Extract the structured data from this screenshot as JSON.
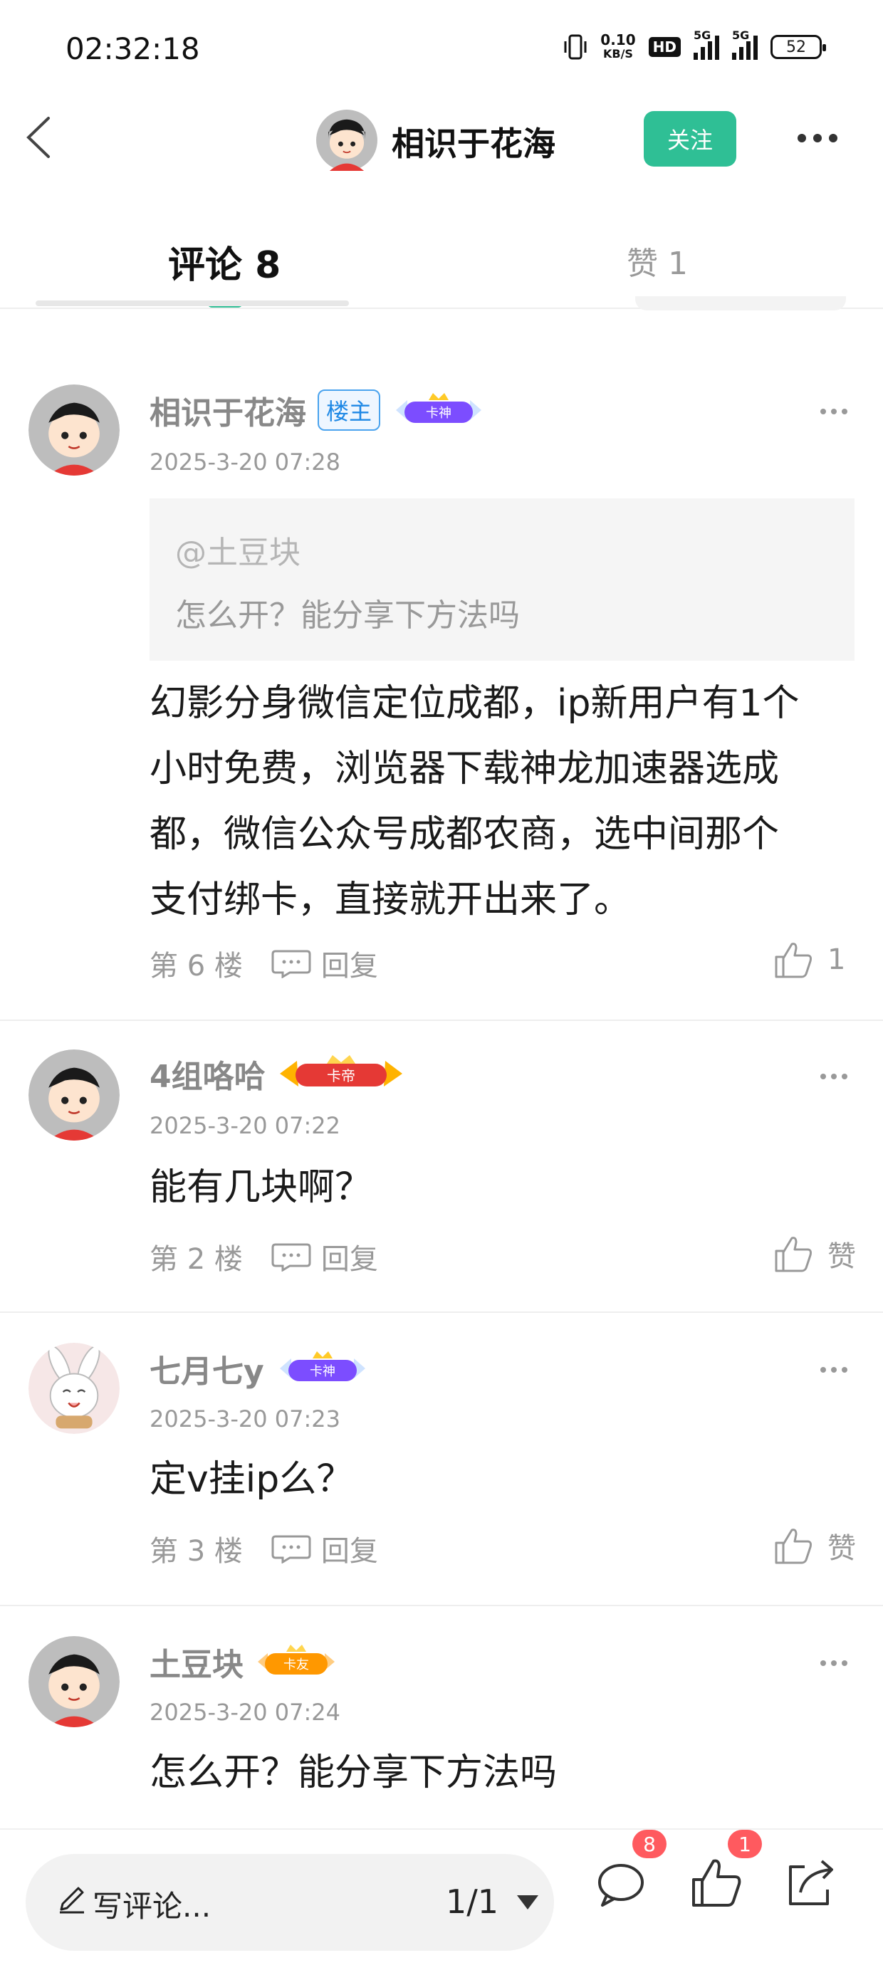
{
  "status_bar": {
    "time": "02:32:18",
    "net_speed_value": "0.10",
    "net_speed_unit": "KB/S",
    "hd_label": "HD",
    "signal1_label": "5G",
    "signal2_label": "5G",
    "battery": "52"
  },
  "header": {
    "author_name": "相识于花海",
    "follow_label": "关注"
  },
  "tabs": {
    "comments_label": "评论 8",
    "likes_label": "赞 1"
  },
  "comments": [
    {
      "user": "相识于花海",
      "owner_badge": "楼主",
      "rank_badge": "卡神",
      "time": "2025-3-20 07:28",
      "quote_user": "@土豆块",
      "quote_text": "怎么开？能分享下方法吗",
      "lines": [
        "幻影分身微信定位成都，ip新用户有1个",
        "小时免费，浏览器下载神龙加速器选成",
        "都，微信公众号成都农商，选中间那个",
        "支付绑卡，直接就开出来了。"
      ],
      "floor": "第 6 楼",
      "reply_label": "回复",
      "likes": "1"
    },
    {
      "user": "4组咯哈",
      "rank_badge": "卡帝",
      "time": "2025-3-20 07:22",
      "lines": [
        "能有几块啊？"
      ],
      "floor": "第 2 楼",
      "reply_label": "回复",
      "likes": "赞"
    },
    {
      "user": "七月七y",
      "rank_badge": "卡神",
      "time": "2025-3-20 07:23",
      "lines": [
        "定v挂ip么？"
      ],
      "floor": "第 3 楼",
      "reply_label": "回复",
      "likes": "赞"
    },
    {
      "user": "土豆块",
      "rank_badge": "卡友",
      "time": "2025-3-20 07:24",
      "lines": [
        "怎么开？能分享下方法吗"
      ]
    }
  ],
  "bottom_bar": {
    "write_placeholder": "写评论...",
    "page_indicator": "1/1",
    "comment_count": "8",
    "like_count": "1"
  },
  "icons": [
    "back-icon",
    "more-icon",
    "reply-icon",
    "like-icon",
    "pen-icon",
    "comment-icon",
    "share-icon",
    "dropdown-caret-icon"
  ],
  "colors": {
    "accent": "#2fbf95",
    "badge_red": "#ff5a5f",
    "owner_badge_blue": "#1e88e5"
  }
}
